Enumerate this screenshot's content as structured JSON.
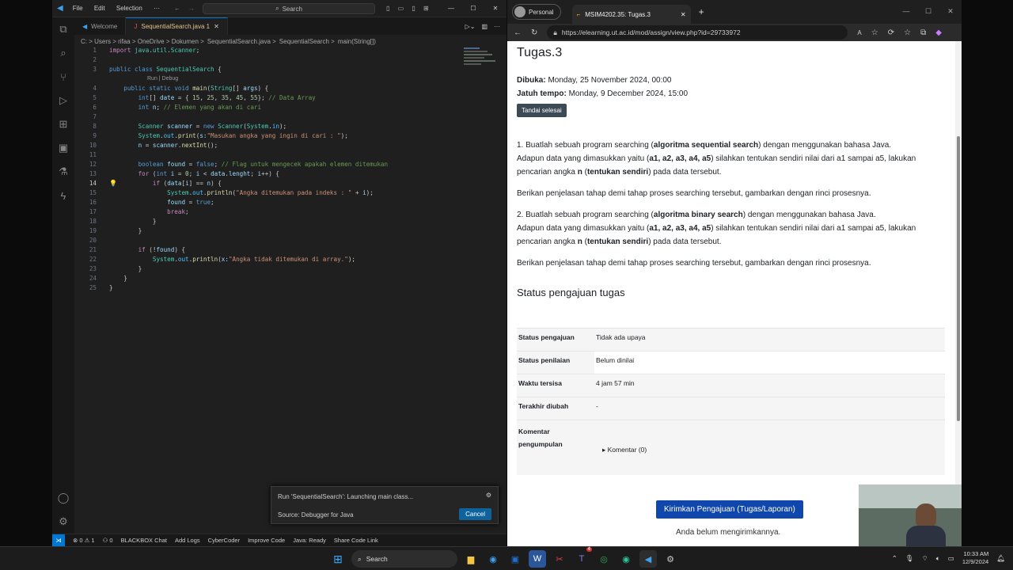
{
  "vscode": {
    "menu": [
      "File",
      "Edit",
      "Selection",
      "···"
    ],
    "search": "Search",
    "tabs": [
      {
        "label": "Welcome"
      },
      {
        "label": "SequentialSearch.java 1"
      }
    ],
    "breadcrumb": [
      "C: > Users > rifaa > OneDrive > Dokumen >",
      "SequentialSearch.java >",
      "SequentialSearch >",
      "main(String[])"
    ],
    "codelens": "Run | Debug",
    "line_numbers": [
      "1",
      "2",
      "3",
      "4",
      "5",
      "6",
      "7",
      "8",
      "9",
      "10",
      "11",
      "12",
      "13",
      "14",
      "15",
      "16",
      "17",
      "18",
      "19",
      "20",
      "21",
      "22",
      "23",
      "24",
      "25"
    ],
    "notification": {
      "title": "Run 'SequentialSearch': Launching main class...",
      "source": "Source: Debugger for Java",
      "cancel": "Cancel"
    },
    "status": {
      "errors": "⊗ 0 ⚠ 1",
      "ports": "⚇ 0",
      "blackbox": "BLACKBOX Chat",
      "logs": "Add Logs",
      "cyber": "CyberCoder",
      "improve": "Improve Code",
      "java": "Java: Ready",
      "share": "Share Code Link"
    }
  },
  "edge": {
    "profile": "Personal",
    "tab_title": "MSIM4202.35: Tugas.3",
    "url": "https://elearning.ut.ac.id/mod/assign/view.php?id=29733972",
    "page": {
      "title": "Tugas.3",
      "opened_label": "Dibuka:",
      "opened_value": "Monday, 25 November 2024, 00:00",
      "due_label": "Jatuh tempo:",
      "due_value": "Monday, 9 December 2024, 15:00",
      "done_button": "Tandai selesai",
      "p1a": "1. Buatlah sebuah program searching (",
      "p1b": "algoritma sequential search",
      "p1c": ") dengan menggunakan bahasa Java.",
      "p1d": "Adapun data yang dimasukkan yaitu (",
      "p1e": "a1, a2, a3, a4, a5",
      "p1f": ") silahkan tentukan sendiri nilai dari a1 sampai a5, lakukan",
      "p1g": "pencarian angka ",
      "p1h": "n",
      "p1i": " (",
      "p1j": "tentukan sendiri",
      "p1k": ") pada data tersebut.",
      "p2": "Berikan penjelasan tahap demi tahap proses searching tersebut, gambarkan dengan rinci prosesnya.",
      "p3a": "2. Buatlah sebuah program searching (",
      "p3b": "algoritma binary search",
      "p3c": ") dengan menggunakan bahasa Java.",
      "p4": "Berikan penjelasan tahap demi tahap proses searching tersebut, gambarkan dengan rinci prosesnya.",
      "status_heading": "Status pengajuan tugas",
      "rows": [
        {
          "k": "Status pengajuan",
          "v": "Tidak ada upaya"
        },
        {
          "k": "Status penilaian",
          "v": "Belum dinilai"
        },
        {
          "k": "Waktu tersisa",
          "v": "4 jam 57 min"
        },
        {
          "k": "Terakhir diubah",
          "v": "-"
        },
        {
          "k": "Komentar pengumpulan",
          "v": "Komentar (0)"
        }
      ],
      "submit": "Kirimkan Pengajuan (Tugas/Laporan)",
      "not_submitted": "Anda belum mengirimkannya."
    }
  },
  "taskbar": {
    "search": "Search",
    "time": "10:33 AM",
    "date": "12/9/2024",
    "badge": "4"
  }
}
